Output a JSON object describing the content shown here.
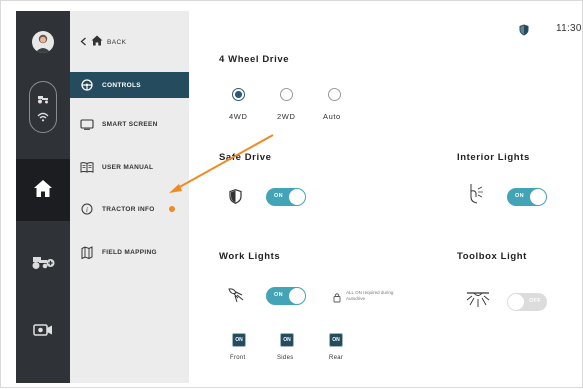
{
  "status": {
    "time": "11:30"
  },
  "nav": {
    "back_label": "BACK"
  },
  "menu": [
    {
      "label": "CONTROLS",
      "icon": "steering-wheel-icon",
      "active": true
    },
    {
      "label": "SMART SCREEN",
      "icon": "screen-icon"
    },
    {
      "label": "USER MANUAL",
      "icon": "book-icon"
    },
    {
      "label": "TRACTOR INFO",
      "icon": "info-icon",
      "badge": "orange-dot"
    },
    {
      "label": "FIELD MAPPING",
      "icon": "map-icon"
    }
  ],
  "rail": [
    "avatar",
    "tractor-icon",
    "wifi-icon",
    "home-icon",
    "tractor-add-icon",
    "camera-icon"
  ],
  "drive": {
    "title": "4 Wheel Drive",
    "options": [
      "4WD",
      "2WD",
      "Auto"
    ],
    "selected": "4WD"
  },
  "safe_drive": {
    "title": "Safe Drive",
    "toggle": "ON"
  },
  "interior_lights": {
    "title": "Interior Lights",
    "toggle": "ON"
  },
  "work_lights": {
    "title": "Work Lights",
    "toggle": "ON",
    "note": "ALL ON required during Autodrive",
    "buttons": [
      {
        "state": "ON",
        "label": "Front"
      },
      {
        "state": "ON",
        "label": "Sides"
      },
      {
        "state": "ON",
        "label": "Rear"
      }
    ]
  },
  "toolbox_light": {
    "title": "Toolbox Light",
    "toggle": "OFF"
  },
  "colors": {
    "accent": "#43a3b7",
    "menu_active": "#244b5e",
    "rail": "#2f3236",
    "annotation": "#f08a24"
  }
}
